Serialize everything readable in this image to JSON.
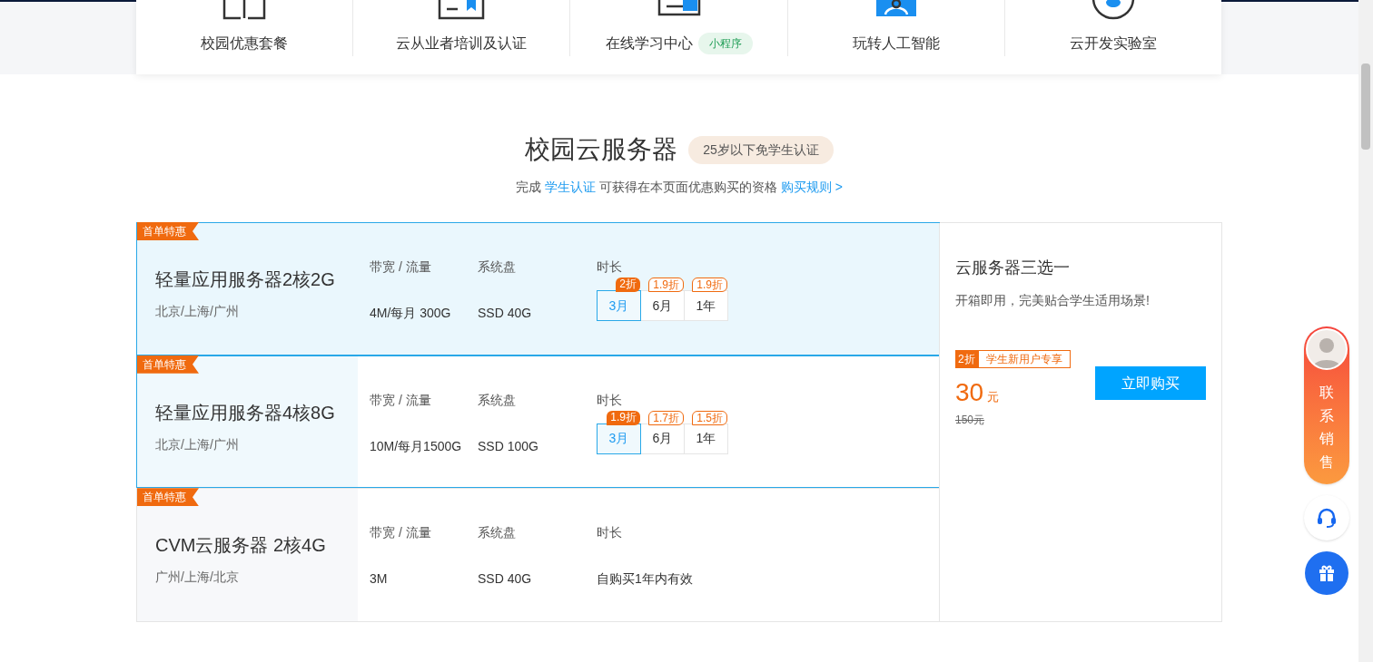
{
  "nav": [
    {
      "label": "校园优惠套餐"
    },
    {
      "label": "云从业者培训及认证"
    },
    {
      "label": "在线学习中心",
      "badge": "小程序"
    },
    {
      "label": "玩转人工智能"
    },
    {
      "label": "云开发实验室"
    }
  ],
  "section": {
    "title": "校园云服务器",
    "badge": "25岁以下免学生认证",
    "subtitle_parts": [
      {
        "text": "完成",
        "link": false
      },
      {
        "text": "学生认证",
        "link": true
      },
      {
        "text": "可获得在本页面优惠购买的资格",
        "link": false
      },
      {
        "text": "购买规则 >",
        "link": true
      }
    ]
  },
  "products": [
    {
      "tag": "首单特惠",
      "name": "轻量应用服务器2核2G",
      "regions": "北京/上海/广州",
      "selected": true,
      "hovered": true,
      "bandwidth_label": "带宽 / 流量",
      "bandwidth": "4M/每月 300G",
      "disk_label": "系统盘",
      "disk": "SSD 40G",
      "duration_label": "时长",
      "options": [
        {
          "label": "3月",
          "discount": "2折",
          "selected": true
        },
        {
          "label": "6月",
          "discount": "1.9折",
          "selected": false
        },
        {
          "label": "1年",
          "discount": "1.9折",
          "selected": false
        }
      ]
    },
    {
      "tag": "首单特惠",
      "name": "轻量应用服务器4核8G",
      "regions": "北京/上海/广州",
      "selected": true,
      "hovered": false,
      "bandwidth_label": "带宽 / 流量",
      "bandwidth": "10M/每月1500G",
      "disk_label": "系统盘",
      "disk": "SSD 100G",
      "duration_label": "时长",
      "options": [
        {
          "label": "3月",
          "discount": "1.9折",
          "selected": true
        },
        {
          "label": "6月",
          "discount": "1.7折",
          "selected": false
        },
        {
          "label": "1年",
          "discount": "1.5折",
          "selected": false
        }
      ]
    },
    {
      "tag": "首单特惠",
      "name": "CVM云服务器 2核4G",
      "regions": "广州/上海/北京",
      "selected": false,
      "hovered": false,
      "bandwidth_label": "带宽 / 流量",
      "bandwidth": "3M",
      "disk_label": "系统盘",
      "disk": "SSD 40G",
      "duration_label": "时长",
      "duration_text": "自购买1年内有效"
    }
  ],
  "summary": {
    "title": "云服务器三选一",
    "description": "开箱即用，完美贴合学生适用场景!",
    "discount": "2折",
    "discount_note": "学生新用户专享",
    "price": "30",
    "unit": "元",
    "original_price": "150元",
    "button": "立即购买"
  },
  "float": {
    "contact_label": "联系销售"
  }
}
